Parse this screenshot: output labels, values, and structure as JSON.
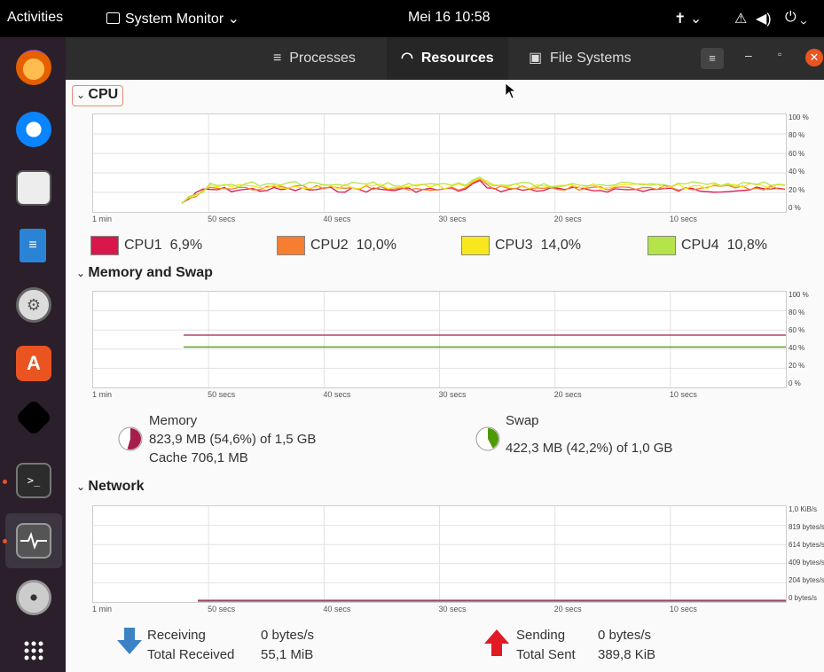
{
  "topbar": {
    "activities": "Activities",
    "app_name": "System Monitor",
    "clock": "Mei 16  10:58"
  },
  "tabs": [
    {
      "label": "Processes",
      "icon": "list-icon",
      "active": false
    },
    {
      "label": "Resources",
      "icon": "gauge-icon",
      "active": true
    },
    {
      "label": "File Systems",
      "icon": "drive-icon",
      "active": false
    }
  ],
  "sections": {
    "cpu": "CPU",
    "memory": "Memory and Swap",
    "network": "Network"
  },
  "time_ticks": [
    "1 min",
    "50 secs",
    "40 secs",
    "30 secs",
    "20 secs",
    "10 secs"
  ],
  "cpu_y_ticks": [
    "100 %",
    "80 %",
    "60 %",
    "40 %",
    "20 %",
    "0 %"
  ],
  "mem_y_ticks": [
    "100 %",
    "80 %",
    "60 %",
    "40 %",
    "20 %",
    "0 %"
  ],
  "net_y_ticks": [
    "1,0 KiB/s",
    "819 bytes/s",
    "614 bytes/s",
    "409 bytes/s",
    "204 bytes/s",
    "0 bytes/s"
  ],
  "cpu_legend": [
    {
      "name": "CPU1",
      "value": "6,9%",
      "color": "#d9174a"
    },
    {
      "name": "CPU2",
      "value": "10,0%",
      "color": "#f57e31"
    },
    {
      "name": "CPU3",
      "value": "14,0%",
      "color": "#f8e71c"
    },
    {
      "name": "CPU4",
      "value": "10,8%",
      "color": "#b4e34a"
    }
  ],
  "memory": {
    "label": "Memory",
    "usage": "823,9 MB (54,6%) of 1,5 GB",
    "cache": "Cache 706,1 MB",
    "percent": 54.6,
    "color": "#a51d4a"
  },
  "swap": {
    "label": "Swap",
    "usage": "422,3 MB (42,2%) of 1,0 GB",
    "percent": 42.2,
    "color": "#4e9a06"
  },
  "network": {
    "receiving_label": "Receiving",
    "receiving_value": "0 bytes/s",
    "total_received_label": "Total Received",
    "total_received_value": "55,1 MiB",
    "sending_label": "Sending",
    "sending_value": "0 bytes/s",
    "total_sent_label": "Total Sent",
    "total_sent_value": "389,8 KiB"
  },
  "dock_apps": [
    "firefox-icon",
    "thunderbird-icon",
    "files-icon",
    "writer-icon",
    "settings-icon",
    "software-store-icon",
    "inkscape-icon",
    "terminal-icon",
    "system-monitor-icon",
    "disc-icon",
    "app-grid-icon"
  ]
}
